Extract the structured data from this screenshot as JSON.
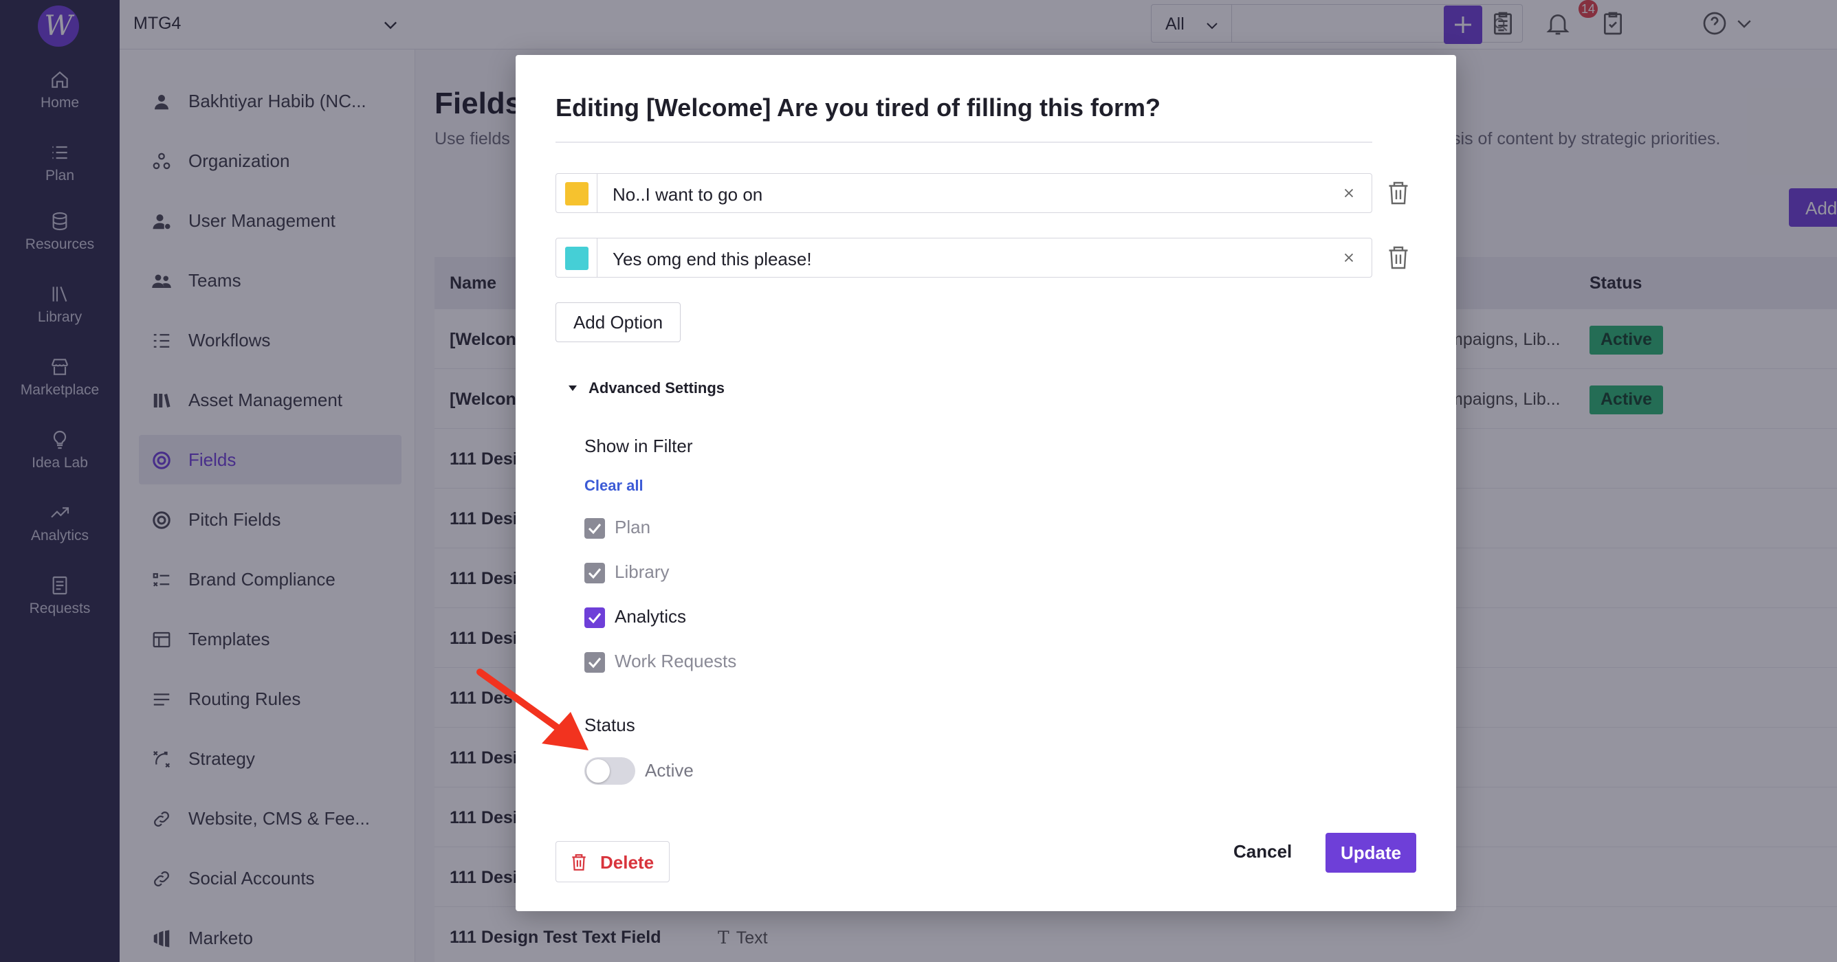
{
  "rail": {
    "logo": "W",
    "items": [
      {
        "label": "Home",
        "icon": "home-icon"
      },
      {
        "label": "Plan",
        "icon": "list-icon"
      },
      {
        "label": "Resources",
        "icon": "database-icon"
      },
      {
        "label": "Library",
        "icon": "library-icon"
      },
      {
        "label": "Marketplace",
        "icon": "store-icon"
      },
      {
        "label": "Idea Lab",
        "icon": "bulb-icon"
      },
      {
        "label": "Analytics",
        "icon": "trend-icon"
      },
      {
        "label": "Requests",
        "icon": "document-icon"
      }
    ]
  },
  "topbar": {
    "workspace": "MTG4",
    "scope": "All",
    "search_placeholder": "",
    "notification_count": "14"
  },
  "subnav": {
    "items": [
      {
        "label": "Bakhtiyar Habib (NC...",
        "icon": "user-icon"
      },
      {
        "label": "Organization",
        "icon": "org-icon"
      },
      {
        "label": "User Management",
        "icon": "user-gear-icon"
      },
      {
        "label": "Teams",
        "icon": "team-icon"
      },
      {
        "label": "Workflows",
        "icon": "workflow-icon"
      },
      {
        "label": "Asset Management",
        "icon": "books-icon"
      },
      {
        "label": "Fields",
        "icon": "target-icon",
        "active": true
      },
      {
        "label": "Pitch Fields",
        "icon": "target-icon"
      },
      {
        "label": "Brand Compliance",
        "icon": "checklist-icon"
      },
      {
        "label": "Templates",
        "icon": "template-icon"
      },
      {
        "label": "Routing Rules",
        "icon": "rules-icon"
      },
      {
        "label": "Strategy",
        "icon": "strategy-icon"
      },
      {
        "label": "Website, CMS & Fee...",
        "icon": "link-icon"
      },
      {
        "label": "Social Accounts",
        "icon": "link-icon"
      },
      {
        "label": "Marketo",
        "icon": "marketo-icon"
      }
    ]
  },
  "page": {
    "title": "Fields",
    "desc_left": "Use fields",
    "desc_right": "lysis of content by strategic priorities.",
    "add_label": "Add",
    "table": {
      "col_name": "Name",
      "col_status": "Status",
      "rows": [
        {
          "name": "[Welcon",
          "context": "mpaigns, Lib...",
          "status": "Active"
        },
        {
          "name": "[Welcon",
          "context": "mpaigns, Lib...",
          "status": "Active"
        },
        {
          "name": "111 Desig",
          "context": "",
          "status": ""
        },
        {
          "name": "111 Desig",
          "context": "",
          "status": ""
        },
        {
          "name": "111 Desig",
          "context": "",
          "status": ""
        },
        {
          "name": "111 Desig",
          "context": "",
          "status": ""
        },
        {
          "name": "111 Des",
          "context": "",
          "status": ""
        },
        {
          "name": "111 Desig",
          "context": "",
          "status": ""
        },
        {
          "name": "111 Desig",
          "context": "",
          "status": ""
        },
        {
          "name": "111 Desig",
          "context": "",
          "status": ""
        }
      ],
      "last_row_name": "111 Design Test Text Field",
      "last_row_type": "Text"
    }
  },
  "modal": {
    "title": "Editing [Welcome] Are you tired of filling this form?",
    "options": [
      {
        "text": "No..I want to go on",
        "color": "#f6c22e"
      },
      {
        "text": "Yes omg end this please!",
        "color": "#45cfd6"
      }
    ],
    "add_option": "Add Option",
    "advanced_settings": "Advanced Settings",
    "show_in_filter": "Show in Filter",
    "clear_all": "Clear all",
    "filters": [
      {
        "label": "Plan",
        "checked": true,
        "enabled": false
      },
      {
        "label": "Library",
        "checked": true,
        "enabled": false
      },
      {
        "label": "Analytics",
        "checked": true,
        "enabled": true
      },
      {
        "label": "Work Requests",
        "checked": true,
        "enabled": false
      }
    ],
    "status_label": "Status",
    "status_toggle_label": "Active",
    "status_on": false,
    "delete": "Delete",
    "cancel": "Cancel",
    "update": "Update"
  },
  "colors": {
    "accent": "#6e3fd8",
    "rail_bg": "#2c2a4a",
    "active_pill": "#2bb673",
    "danger": "#d8343c",
    "annotation_arrow": "#f2331f"
  }
}
